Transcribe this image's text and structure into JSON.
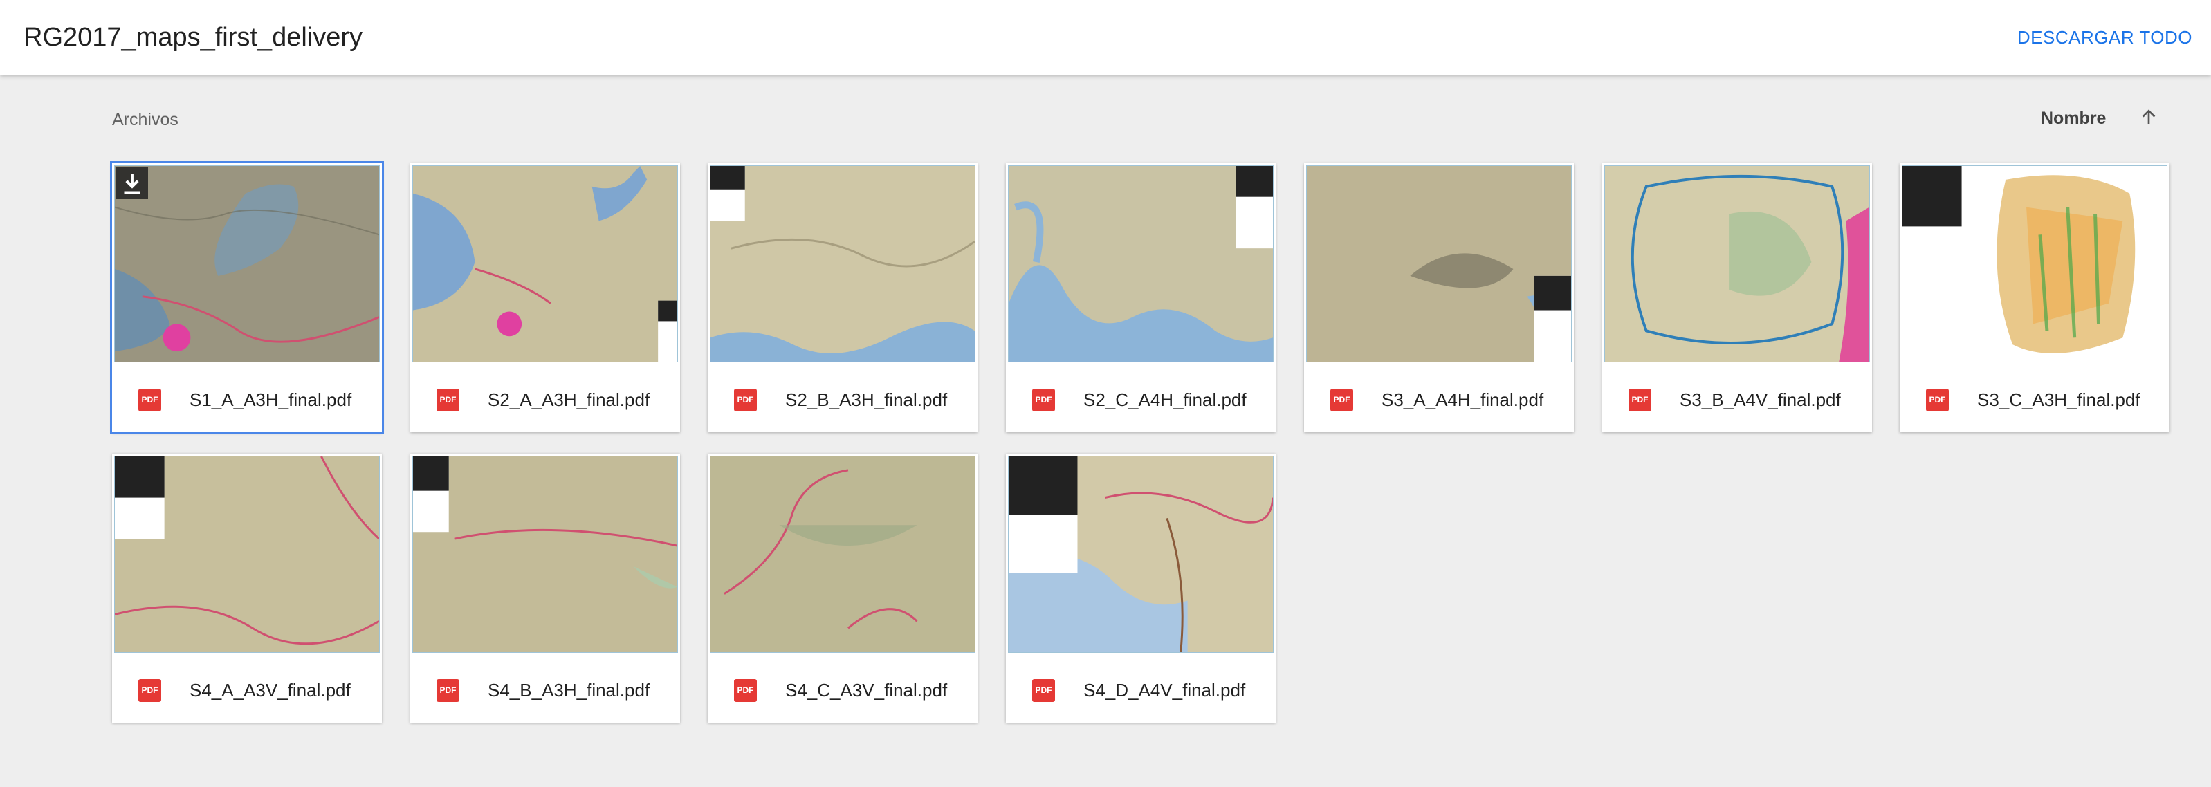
{
  "header": {
    "title": "RG2017_maps_first_delivery",
    "download_all_label": "DESCARGAR TODO"
  },
  "files_section": {
    "label": "Archivos",
    "sort_label": "Nombre",
    "sort_icon": "arrow-upward-icon"
  },
  "files": [
    {
      "name": "S1_A_A3H_final.pdf",
      "type_badge": "PDF",
      "selected": true
    },
    {
      "name": "S2_A_A3H_final.pdf",
      "type_badge": "PDF"
    },
    {
      "name": "S2_B_A3H_final.pdf",
      "type_badge": "PDF"
    },
    {
      "name": "S2_C_A4H_final.pdf",
      "type_badge": "PDF"
    },
    {
      "name": "S3_A_A4H_final.pdf",
      "type_badge": "PDF"
    },
    {
      "name": "S3_B_A4V_final.pdf",
      "type_badge": "PDF"
    },
    {
      "name": "S3_C_A3H_final.pdf",
      "type_badge": "PDF"
    },
    {
      "name": "S4_A_A3V_final.pdf",
      "type_badge": "PDF"
    },
    {
      "name": "S4_B_A3H_final.pdf",
      "type_badge": "PDF"
    },
    {
      "name": "S4_C_A3V_final.pdf",
      "type_badge": "PDF"
    },
    {
      "name": "S4_D_A4V_final.pdf",
      "type_badge": "PDF"
    }
  ],
  "colors": {
    "accent": "#1a73e8",
    "pdf_badge": "#e53935",
    "selected_outline": "#4a86e8"
  }
}
